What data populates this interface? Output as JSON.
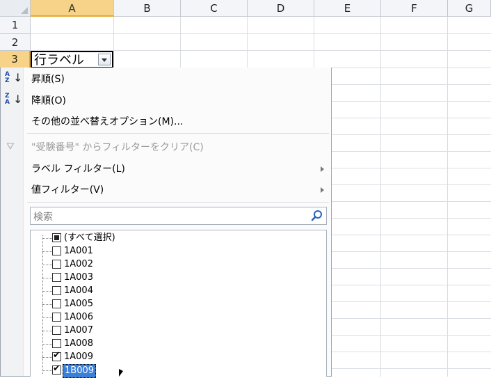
{
  "columns": [
    "A",
    "B",
    "C",
    "D",
    "E",
    "F",
    "G"
  ],
  "rows": [
    "1",
    "2",
    "3"
  ],
  "cell_a3": {
    "text": "行ラベル"
  },
  "menu": {
    "sort_asc": "昇順(S)",
    "sort_desc": "降順(O)",
    "sort_other": "その他の並べ替えオプション(M)...",
    "clear_filter": "\"受験番号\" からフィルターをクリア(C)",
    "label_filter": "ラベル フィルター(L)",
    "value_filter": "値フィルター(V)",
    "search_placeholder": "検索"
  },
  "sort_icon_letters": {
    "asc": [
      "A",
      "Z"
    ],
    "desc": [
      "Z",
      "A"
    ]
  },
  "list": [
    {
      "label": "(すべて選択)",
      "state": "partial"
    },
    {
      "label": "1A001",
      "state": "unchecked"
    },
    {
      "label": "1A002",
      "state": "unchecked"
    },
    {
      "label": "1A003",
      "state": "unchecked"
    },
    {
      "label": "1A004",
      "state": "unchecked"
    },
    {
      "label": "1A005",
      "state": "unchecked"
    },
    {
      "label": "1A006",
      "state": "unchecked"
    },
    {
      "label": "1A007",
      "state": "unchecked"
    },
    {
      "label": "1A008",
      "state": "unchecked"
    },
    {
      "label": "1A009",
      "state": "checked"
    },
    {
      "label": "1B009",
      "state": "checked",
      "highlight": true
    }
  ],
  "colors": {
    "selected_header": "#f7d38a",
    "selection_highlight": "#3b7fd9"
  }
}
